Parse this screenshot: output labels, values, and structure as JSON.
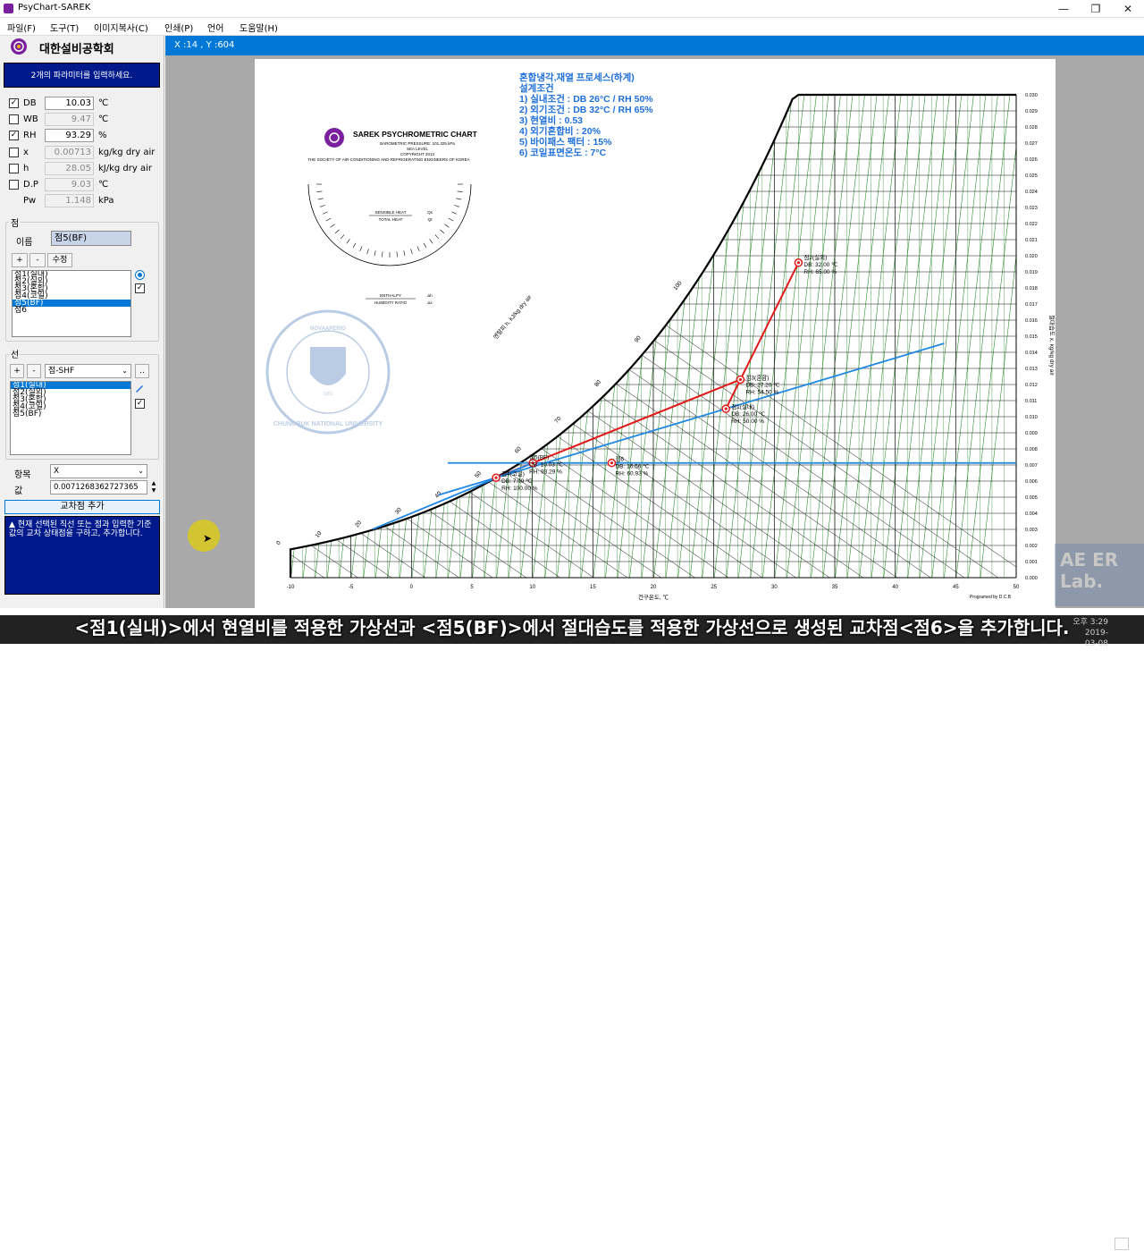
{
  "window": {
    "title": "PsyChart-SAREK",
    "min": "—",
    "max": "❐",
    "close": "✕"
  },
  "menu": [
    "파일(F)",
    "도구(T)",
    "이미지복사(C)",
    "인쇄(P)",
    "언어",
    "도움말(H)"
  ],
  "left": {
    "society": "대한설비공학회",
    "instruction": "2개의 파라미터를 입력하세요.",
    "params": [
      {
        "label": "DB",
        "checked": true,
        "value": "10.03",
        "unit": "℃",
        "enabled": true
      },
      {
        "label": "WB",
        "checked": false,
        "value": "9.47",
        "unit": "℃",
        "enabled": false
      },
      {
        "label": "RH",
        "checked": true,
        "value": "93.29",
        "unit": "%",
        "enabled": true
      },
      {
        "label": "x",
        "checked": false,
        "value": "0.00713",
        "unit": "kg/kg dry air",
        "enabled": false
      },
      {
        "label": "h",
        "checked": false,
        "value": "28.05",
        "unit": "kJ/kg dry air",
        "enabled": false
      },
      {
        "label": "D.P",
        "checked": false,
        "value": "9.03",
        "unit": "℃",
        "enabled": false
      },
      {
        "label": "Pw",
        "checked": null,
        "value": "1.148",
        "unit": "kPa",
        "enabled": false
      }
    ],
    "points": {
      "group_label": "점",
      "name_label": "이름",
      "name_value": "점5(BF)",
      "plus": "+",
      "minus": "-",
      "edit": "수정",
      "items": [
        "점1(실내)",
        "점2(실외)",
        "점3(혼합)",
        "점4(코일)",
        "점5(BF)",
        "점6"
      ],
      "selected": 4
    },
    "lines": {
      "group_label": "선",
      "plus": "+",
      "minus": "-",
      "combo": "점-SHF",
      "more": "..",
      "items": [
        "점1(실내)",
        "점2(실외)",
        "점3(혼합)",
        "점4(코일)",
        "점5(BF)"
      ],
      "selected": 0
    },
    "item_label": "항목",
    "item_value": "X",
    "value_label": "값",
    "value_value": "0.0071268362727365",
    "add_cross": "교차점 추가",
    "help": "▲ 현재 선택된 직선 또는 점과 입력한 기준값의 교차 상태점을 구하고, 추가합니다."
  },
  "status": {
    "coord": "X :14 , Y :604"
  },
  "chart": {
    "header_title": "SAREK PSYCHROMETRIC CHART",
    "header_sub1": "BAROMETRIC PRESSURE: 101.325 kPa",
    "header_sub2": "SEA LEVEL",
    "header_sub3": "COPYRIGHT 2013",
    "header_sub4": "THE SOCIETY OF AIR-CONDITIONING AND REFRIGERATING ENGINEERS OF KOREA",
    "shr_num": "SENSIBLE HEAT",
    "shr_den": "TOTAL HEAT",
    "shr_eq_num": "Qs",
    "shr_eq_den": "Qt",
    "enth_num": "ENTHALPY",
    "enth_den": "HUMIDITY RATIO",
    "enth_eq_num": "Δh",
    "enth_eq_den": "Δx",
    "seal_top": "NOVAAPERIO",
    "seal_bottom": "CHUNGBUK NATIONAL UNIVERSITY",
    "seal_year": "1951",
    "notes": [
      "혼합냉각,재열 프로세스(하계)",
      "설계조건",
      "1) 실내조건 : DB 26°C / RH 50%",
      "2) 외기조건 : DB 32°C / RH 65%",
      "3) 현열비 : 0.53",
      "4) 외기혼합비 : 20%",
      "5) 바이패스 팩터 : 15%",
      "6) 코일표면온도 : 7°C"
    ],
    "xlabel": "건구온도, ℃",
    "ylabel": "절대습도 x, kg/kg dry air",
    "enth_label": "엔탈피 h, kJ/kg dry air",
    "programmed": "Programed by D.C.B",
    "x_ticks": [
      "-10",
      "-5",
      "0",
      "5",
      "10",
      "15",
      "20",
      "25",
      "30",
      "35",
      "40",
      "45",
      "50"
    ],
    "y_ticks": [
      "0.000",
      "0.001",
      "0.002",
      "0.003",
      "0.004",
      "0.005",
      "0.006",
      "0.007",
      "0.008",
      "0.009",
      "0.010",
      "0.011",
      "0.012",
      "0.013",
      "0.014",
      "0.015",
      "0.016",
      "0.017",
      "0.018",
      "0.019",
      "0.020",
      "0.021",
      "0.022",
      "0.023",
      "0.024",
      "0.025",
      "0.026",
      "0.027",
      "0.028",
      "0.029",
      "0.030"
    ],
    "enth_ticks": [
      "100",
      "90",
      "80",
      "70",
      "60",
      "50",
      "40",
      "30",
      "20",
      "10",
      "0",
      "-10"
    ],
    "pt1": {
      "label": "점1(실내)",
      "db": "DB: 26.00 ℃",
      "rh": "RH: 50.00 %"
    },
    "pt2": {
      "label": "점2(실외)",
      "db": "DB: 32.00 ℃",
      "rh": "RH: 65.00 %"
    },
    "pt3": {
      "label": "점3(혼합)",
      "db": "DB: 27.20 ℃",
      "rh": "RH: 54.50 %"
    },
    "pt4": {
      "label": "점4(코일)",
      "db": "DB: 7.00 ℃",
      "rh": "RH: 100.00 %"
    },
    "pt5": {
      "label": "점5(BF)",
      "db": "DB: 10.03 ℃",
      "rh": "RH: 93.29 %"
    },
    "pt6": {
      "label": "점6",
      "db": "DB: 16.56 ℃",
      "rh": "RH: 60.93 %"
    },
    "colors": {
      "red": "#e21a1a",
      "blue": "#1e88e5",
      "green": "#2f8f2f",
      "pointfill": "#ffffff"
    }
  },
  "overlay": {
    "lab": "AE ER Lab.",
    "subtitle": "<점1(실내)>에서 현열비를 적용한 가상선과 <점5(BF)>에서 절대습도를 적용한 가상선으로 생성된 교차점<점6>을 추가합니다.",
    "clock_time": "오후 3:29",
    "clock_date": "2019-03-08"
  }
}
